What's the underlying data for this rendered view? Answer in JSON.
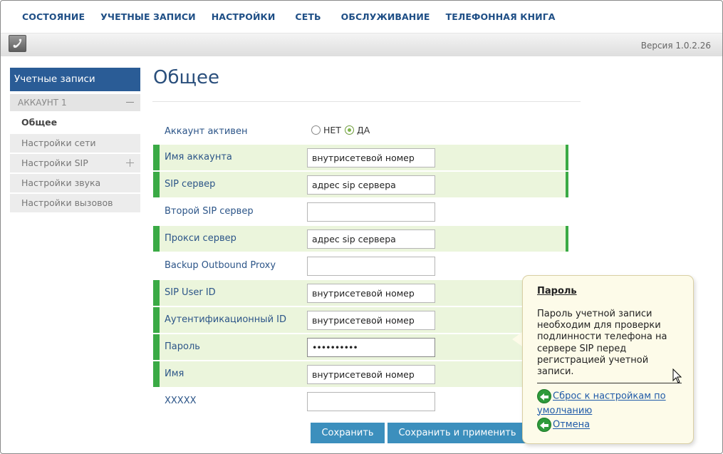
{
  "nav": {
    "items": [
      "СОСТОЯНИЕ",
      "УЧЕТНЫЕ ЗАПИСИ",
      "НАСТРОЙКИ",
      "СЕТЬ",
      "ОБСЛУЖИВАНИЕ",
      "ТЕЛЕФОННАЯ КНИГА"
    ]
  },
  "header": {
    "version": "Версия 1.0.2.26"
  },
  "sidebar": {
    "section_title": "Учетные записи",
    "account_header": "АККАУНТ 1",
    "items": [
      "Общее",
      "Настройки сети",
      "Настройки SIP",
      "Настройки звука",
      "Настройки вызовов"
    ]
  },
  "main": {
    "title": "Общее",
    "account_active": {
      "label": "Аккаунт активен",
      "option_no": "НЕТ",
      "option_yes": "ДА",
      "selected": "ДА"
    },
    "fields": [
      {
        "label": "Имя аккаунта",
        "value": "внутрисетевой номер"
      },
      {
        "label": "SIP сервер",
        "value": "адрес sip сервера"
      },
      {
        "label": "Второй SIP сервер",
        "value": ""
      },
      {
        "label": "Прокси сервер",
        "value": "адрес sip сервера"
      },
      {
        "label": "Backup Outbound Proxy",
        "value": ""
      },
      {
        "label": "SIP User ID",
        "value": "внутрисетевой номер"
      },
      {
        "label": "Аутентификационный ID",
        "value": "внутрисетевой номер"
      },
      {
        "label": "Пароль",
        "value": "••••••••••"
      },
      {
        "label": "Имя",
        "value": "внутрисетевой номер"
      },
      {
        "label": "XXXXX",
        "value": ""
      }
    ],
    "buttons": {
      "save": "Сохранить",
      "save_apply": "Сохранить и применить"
    }
  },
  "tooltip": {
    "title": "Пароль",
    "body": "Пароль учетной записи необходим для проверки подлинности телефона на сервере SIP перед регистрацией учетной записи.",
    "reset_link": "Сброс к настройкам по умолчанию",
    "cancel_link": "Отмена"
  },
  "colors": {
    "nav_text": "#1f4f86",
    "sidebar_active": "#2a5c96",
    "row_highlight": "#ebf5dc",
    "row_accent": "#3aaa45",
    "button": "#3c8fbd"
  }
}
